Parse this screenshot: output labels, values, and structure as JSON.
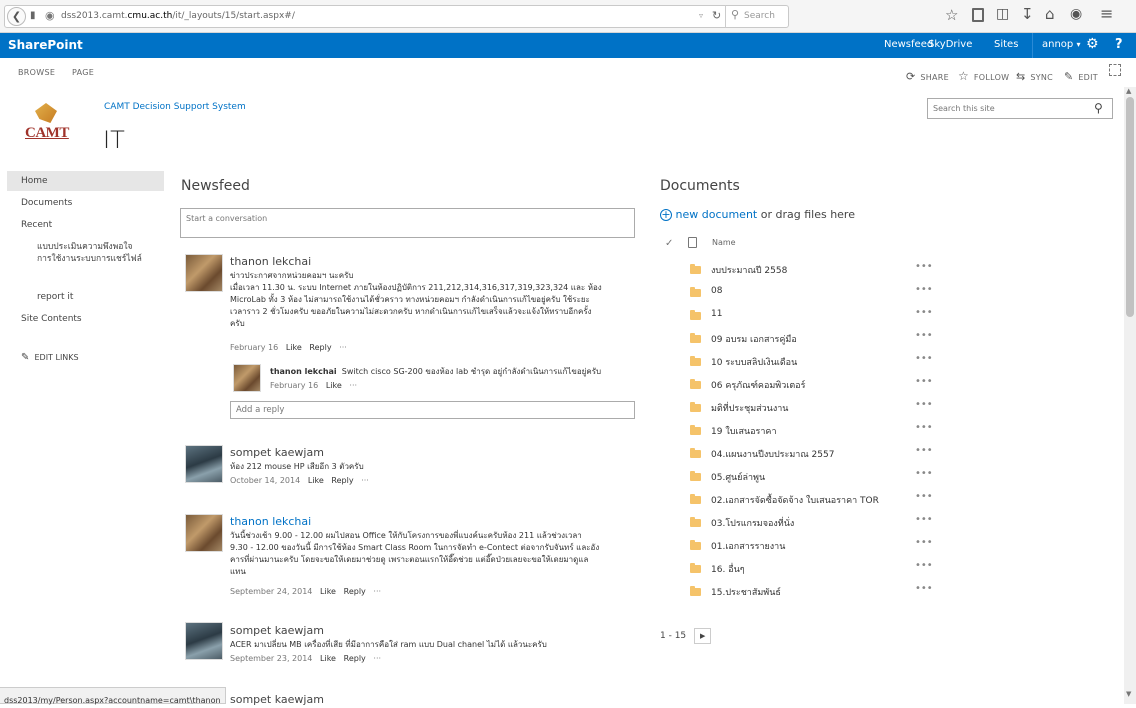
{
  "browser": {
    "url_prefix": "dss2013.camt.",
    "url_domain": "cmu.ac.th",
    "url_path": "/it/_layouts/15/start.aspx#/",
    "search_placeholder": "Search"
  },
  "sharepoint": {
    "brand": "SharePoint",
    "links": [
      "Newsfeed",
      "SkyDrive",
      "Sites"
    ],
    "user": "annop",
    "question": "?"
  },
  "ribbon": {
    "tabs": [
      "BROWSE",
      "PAGE"
    ],
    "share": "SHARE",
    "follow": "FOLLOW",
    "sync": "SYNC",
    "edit": "EDIT"
  },
  "site": {
    "logo_text": "CAMT",
    "parent": "CAMT Decision Support System",
    "title": "IT",
    "search_placeholder": "Search this site"
  },
  "nav": {
    "home": "Home",
    "documents": "Documents",
    "recent": "Recent",
    "recent_item_1": "แบบประเมินความพึงพอใจการใช้งานระบบการแชร์ไฟล์",
    "recent_item_2": "report it",
    "site_contents": "Site Contents",
    "edit_links": "EDIT LINKS"
  },
  "newsfeed": {
    "heading": "Newsfeed",
    "start_placeholder": "Start a conversation",
    "like": "Like",
    "reply": "Reply",
    "add_reply": "Add a reply",
    "posts": [
      {
        "name": "thanon lekchai",
        "line1": "ข่าวประกาศจากหน่วยคอมฯ นะครับ",
        "line2": "เมื่อเวลา 11.30 น. ระบบ Internet ภายในห้องปฏิบัติการ 211,212,314,316,317,319,323,324 และ ห้อง",
        "line3": "MicroLab ทั้ง 3 ห้อง ไม่สามารถใช้งานได้ชั่วคราว ทางหน่วยคอมฯ กำลังดำเนินการแก้ไขอยู่ครับ ใช้ระยะ",
        "line4": "เวลาราว 2 ชั่วโมงครับ ขออภัยในความไม่สะดวกครับ หากดำเนินการแก้ไขเสร็จแล้วจะแจ้งให้ทราบอีกครั้ง",
        "line5": "ครับ",
        "date": "February 16",
        "reply_name": "thanon lekchai",
        "reply_text": "Switch cisco SG-200 ของห้อง lab ชำรุด อยู่กำลังดำเนินการแก้ไขอยู่ครับ",
        "reply_date": "February 16"
      },
      {
        "name": "sompet kaewjam",
        "line1": "ห้อง 212 mouse HP เสียอีก 3 ตัวครับ",
        "date": "October 14, 2014"
      },
      {
        "name": "thanon lekchai",
        "line1": "วันนี้ช่วงเช้า 9.00 - 12.00 ผมไปสอน Office ให้กับโครงการของพี่แบงค์นะครับห้อง 211 แล้วช่วงเวลา",
        "line2": "9.30 - 12.00 ของวันนี้ มีการใช้ห้อง Smart Class Room ในการจัดทำ e-Contect ต่อจากรับจันทร์ และอัง",
        "line3": "คารที่ผ่านมานะครับ โดยจะขอให้เดยมาช่วยดู เพราะตอนแรกให้อี๊ดช่วย แต่อี๊ดป่วยเลยจะขอให้เดยมาดูแล",
        "line4": "แทน",
        "date": "September 24, 2014"
      },
      {
        "name": "sompet kaewjam",
        "line1": "ACER มาเปลี่ยน MB เครื่องที่เสีย ที่มีอาการคือใส่ ram แบบ Dual chanel ไม่ได้ แล้วนะครับ",
        "date": "September 23, 2014"
      },
      {
        "name": "sompet kaewjam"
      }
    ]
  },
  "documents": {
    "heading": "Documents",
    "new_doc": "new document",
    "or_drag": "or drag files here",
    "col_name": "Name",
    "items": [
      "งบประมาณปี 2558",
      "08",
      "11",
      "09 อบรม เอกสารคู่มือ",
      "10 ระบบสลิปเงินเดือน",
      "06 ครุภัณฑ์คอมพิวเตอร์",
      "มติที่ประชุมส่วนงาน",
      "19 ใบเสนอราคา",
      "04.แผนงานปีงบประมาณ 2557",
      "05.ศูนย์ล่าพูน",
      "02.เอกสารจัดซื้อจัดจ้าง ใบเสนอราคา TOR",
      "03.โปรแกรมจองที่นั่ง",
      "01.เอกสารรายงาน",
      "16. อื่นๆ",
      "15.ประชาสัมพันธ์"
    ],
    "ellipsis": "•••",
    "pager": "1 - 15"
  },
  "statusbar": {
    "text": "dss2013/my/Person.aspx?accountname=camt\\thanon"
  }
}
